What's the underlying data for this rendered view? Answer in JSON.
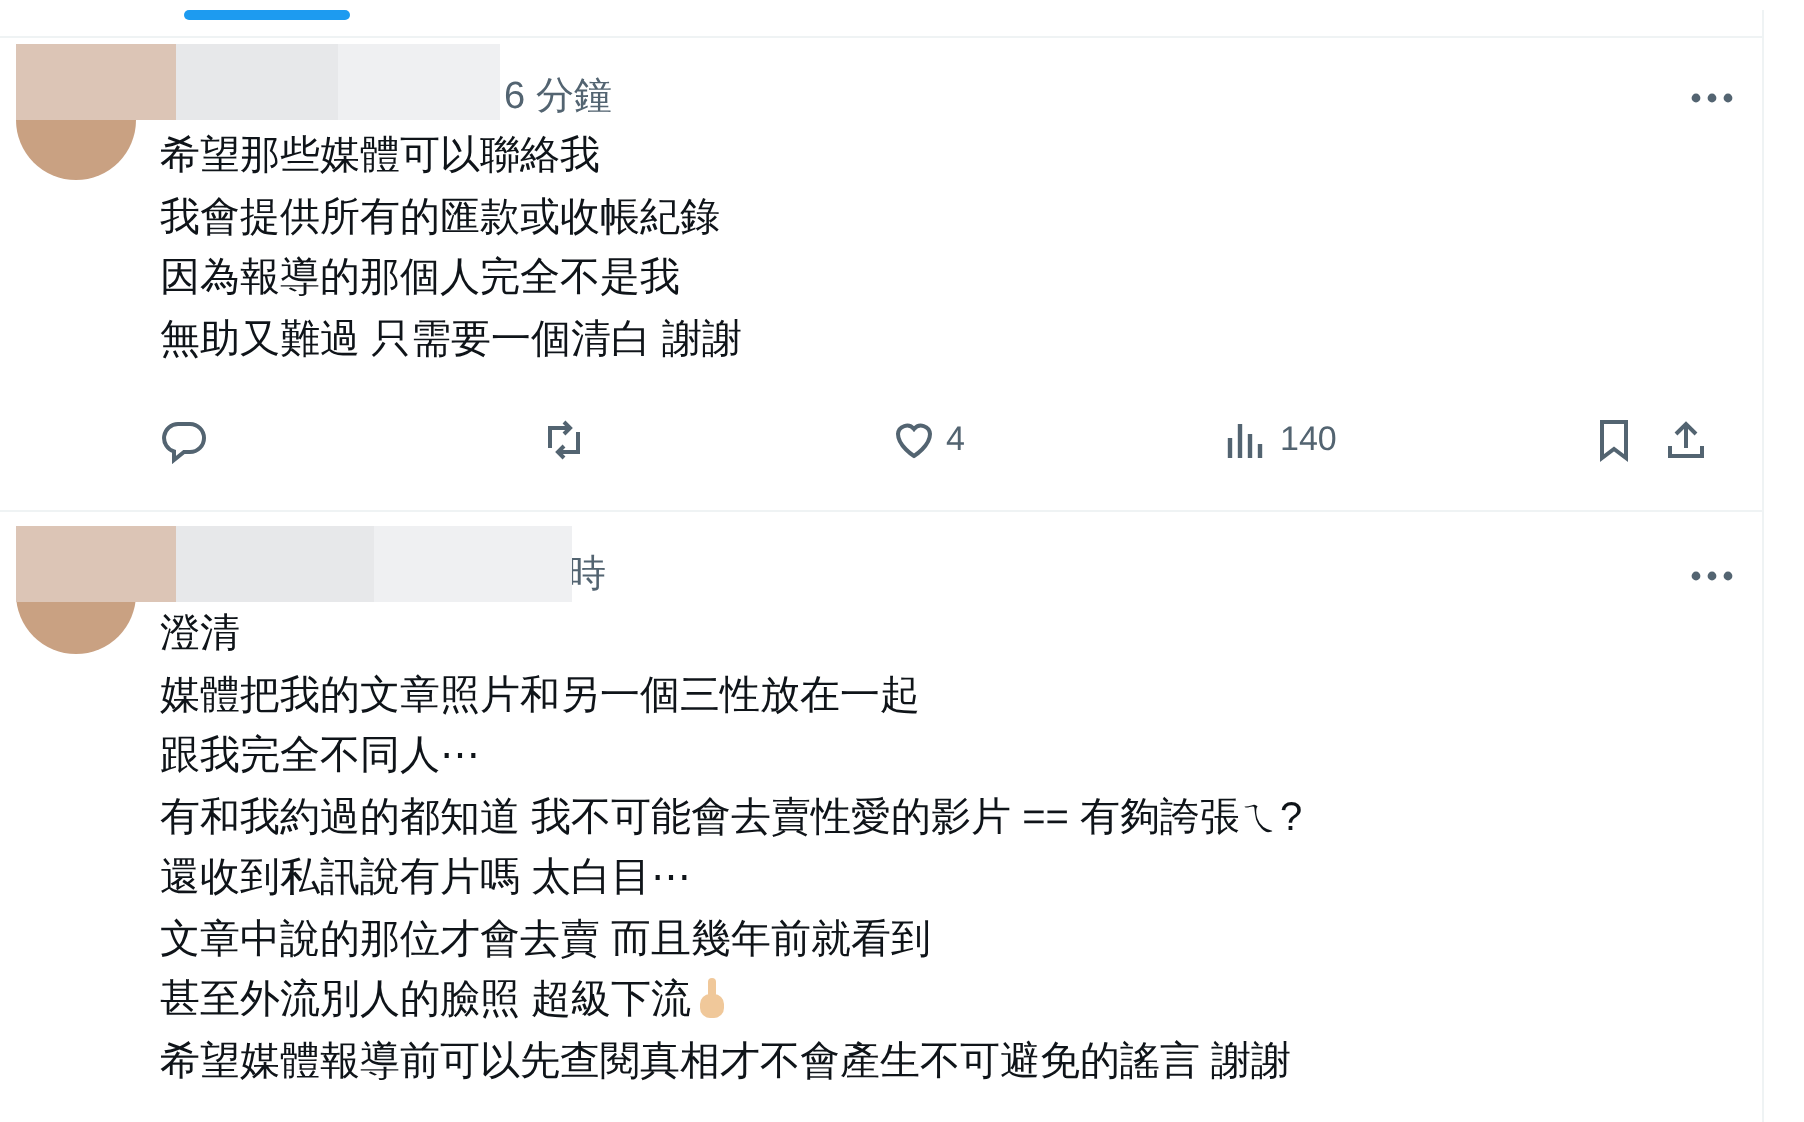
{
  "posts": [
    {
      "author_redacted": true,
      "time": "6 分鐘",
      "lines": [
        {
          "text": "希望那些媒體可以聯絡我"
        },
        {
          "text": "我會提供所有的匯款或收帳紀錄"
        },
        {
          "text": "因為報導的那個人完全不是我"
        },
        {
          "text": "無助又難過 只需要一個清白 謝謝"
        }
      ],
      "actions": {
        "likes": "4",
        "views": "140"
      }
    },
    {
      "author_redacted": true,
      "time": "時",
      "lines": [
        {
          "text": "澄清"
        },
        {
          "text": "媒體把我的文章照片和另一個三性放在一起"
        },
        {
          "text": "跟我完全不同人⋯"
        },
        {
          "text": "有和我約過的都知道 我不可能會去賣性愛的影片 == 有夠誇張ㄟ?"
        },
        {
          "text": "還收到私訊說有片嗎 太白目⋯"
        },
        {
          "text": "文章中說的那位才會去賣 而且幾年前就看到"
        },
        {
          "text": "甚至外流別人的臉照 超級下流",
          "emoji_icon": true
        },
        {
          "text": "希望媒體報導前可以先查閱真相才不會產生不可避免的謠言 謝謝"
        }
      ]
    }
  ]
}
